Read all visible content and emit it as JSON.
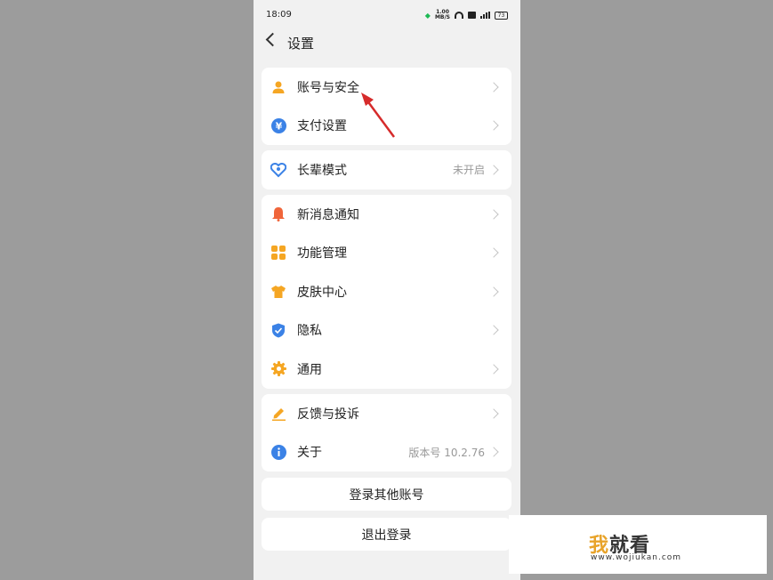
{
  "status_bar": {
    "time": "18:09",
    "net_speed_value": "1.00",
    "net_speed_unit": "MB/S",
    "hd": "HD",
    "battery": "73"
  },
  "header": {
    "title": "设置"
  },
  "groups": [
    [
      {
        "label": "账号与安全",
        "value": "",
        "icon": "person-icon",
        "color": "#f5a623"
      },
      {
        "label": "支付设置",
        "value": "",
        "icon": "yen-icon",
        "color": "#3b82e6"
      }
    ],
    [
      {
        "label": "长辈模式",
        "value": "未开启",
        "icon": "heart-icon",
        "color": "#3b82e6"
      }
    ],
    [
      {
        "label": "新消息通知",
        "value": "",
        "icon": "bell-icon",
        "color": "#f0653a"
      },
      {
        "label": "功能管理",
        "value": "",
        "icon": "grid-icon",
        "color": "#f5a623"
      },
      {
        "label": "皮肤中心",
        "value": "",
        "icon": "shirt-icon",
        "color": "#f5a623"
      },
      {
        "label": "隐私",
        "value": "",
        "icon": "shield-icon",
        "color": "#3b82e6"
      },
      {
        "label": "通用",
        "value": "",
        "icon": "gear-icon",
        "color": "#f5a623"
      }
    ],
    [
      {
        "label": "反馈与投诉",
        "value": "",
        "icon": "pen-icon",
        "color": "#f5a623"
      },
      {
        "label": "关于",
        "value": "版本号 10.2.76",
        "icon": "info-icon",
        "color": "#3b82e6"
      }
    ]
  ],
  "buttons": {
    "login_other": "登录其他账号",
    "logout": "退出登录"
  },
  "watermark": {
    "title_a": "我",
    "title_b": "就看",
    "url": "www.wojiukan.com"
  },
  "colors": {
    "annotation_arrow": "#d62b2b",
    "background": "#9c9c9c",
    "page": "#f1f1f1"
  }
}
